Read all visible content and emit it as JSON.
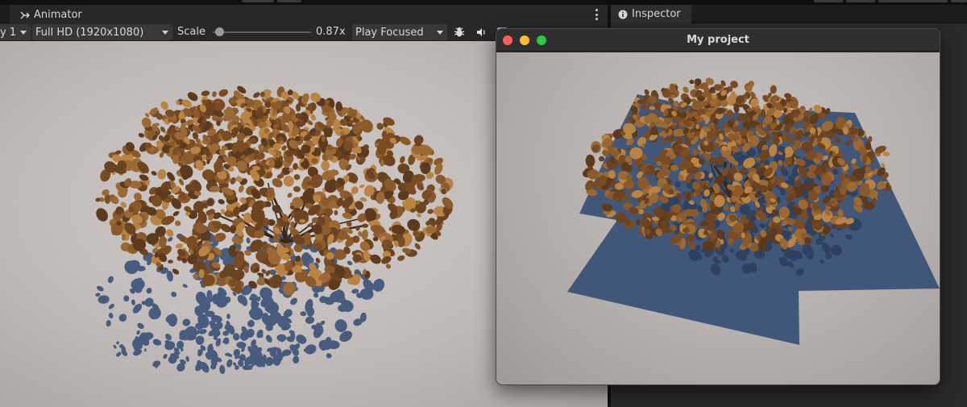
{
  "tabs": {
    "animator": {
      "label": "Animator",
      "icon": "animator-icon"
    },
    "inspector": {
      "label": "Inspector",
      "icon": "info-icon"
    }
  },
  "toolbar": {
    "display_dropdown": "y 1",
    "resolution_dropdown": "Full HD (1920x1080)",
    "scale_label": "Scale",
    "scale_value": "0.87x",
    "scale_fraction": 0.05,
    "play_mode_dropdown": "Play Focused",
    "icons": [
      "bug-icon",
      "audio-icon",
      "stats-icon"
    ]
  },
  "window": {
    "title": "My project",
    "controls": [
      "close",
      "minimize",
      "maximize"
    ],
    "traffic_colors": {
      "close": "#ff5f57",
      "minimize": "#febc2e",
      "maximize": "#28c840"
    }
  },
  "colors": {
    "leaf_brown": "#8a5a2b",
    "leaf_light": "#b98443",
    "shadow_blue": "#3d5479",
    "ground_plane_blue": "#3c5478"
  }
}
